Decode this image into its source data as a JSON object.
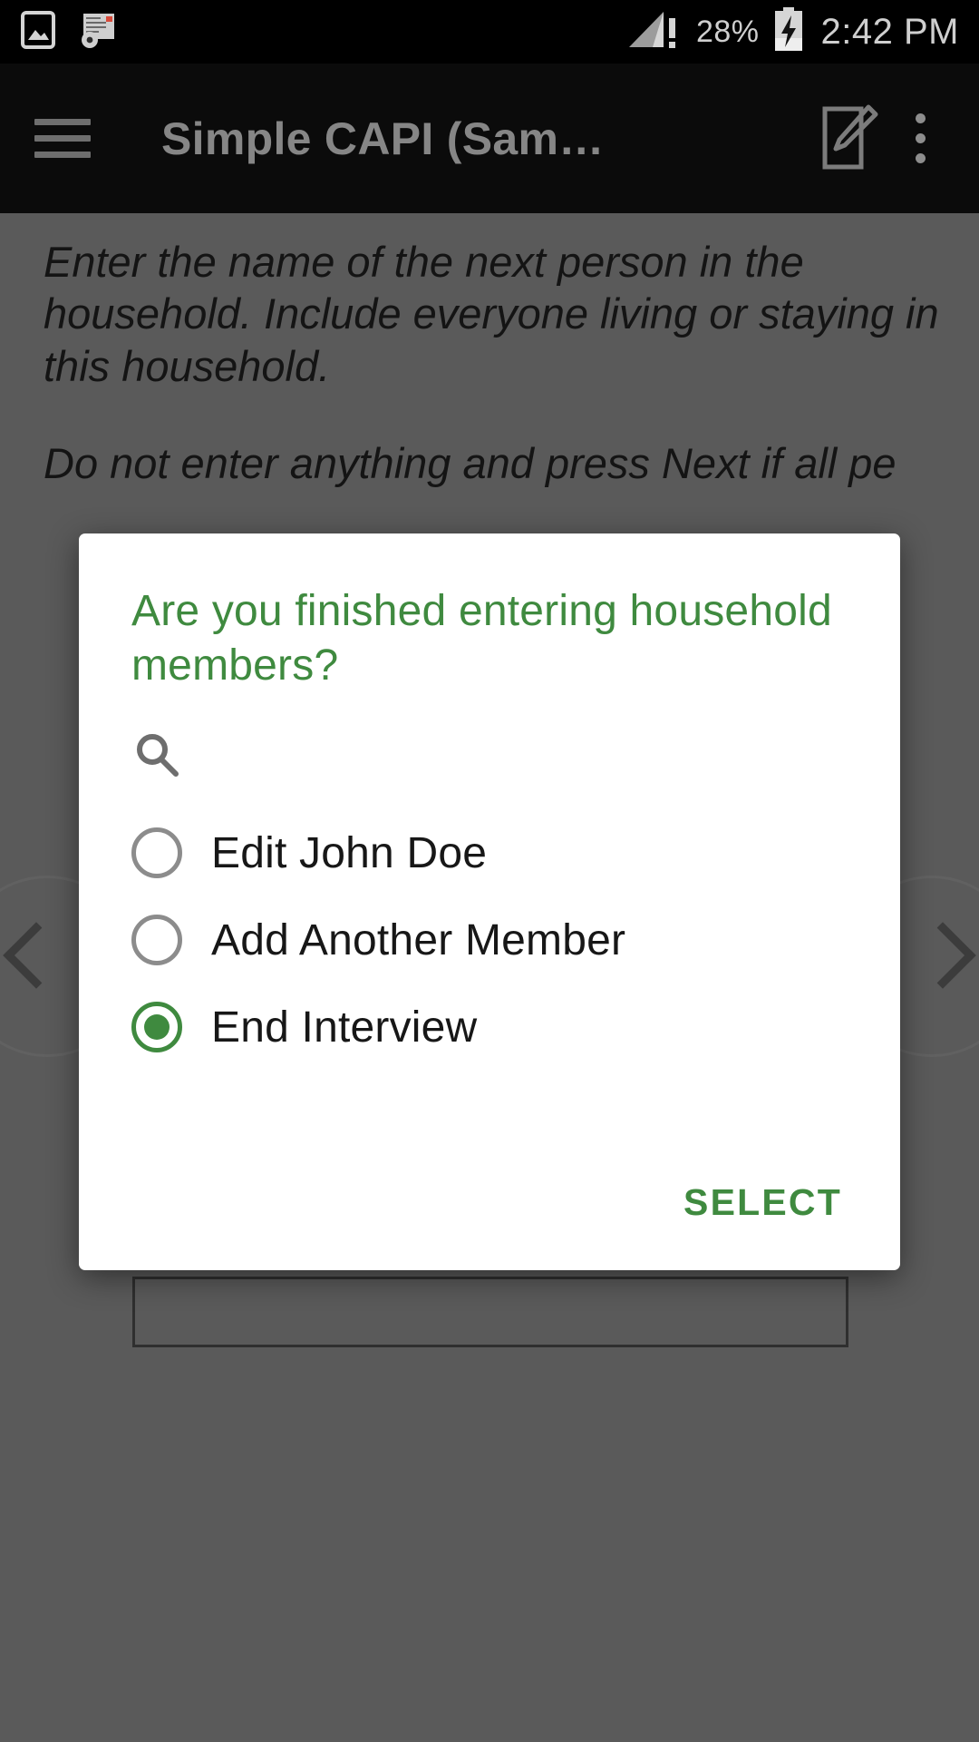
{
  "status_bar": {
    "notification_icons": [
      "image-icon",
      "document-settings-icon"
    ],
    "signal_icon": "signal-bars-warning-icon",
    "battery_percent": "28%",
    "battery_icon": "battery-charging-icon",
    "clock": "2:42 PM"
  },
  "app_bar": {
    "menu_icon": "hamburger-menu-icon",
    "title": "Simple CAPI (Sam…",
    "edit_icon": "note-edit-icon",
    "overflow_icon": "overflow-menu-icon"
  },
  "question": {
    "paragraph_1": "Enter the name of the next person in the household. Include everyone living or staying in this household.",
    "paragraph_2": "Do not enter anything and press Next if all pe",
    "answer_value": "",
    "prev_icon": "chevron-left-icon",
    "next_icon": "chevron-right-icon"
  },
  "dialog": {
    "title": "Are you finished entering household members?",
    "search_icon": "search-icon",
    "search_value": "",
    "search_placeholder": "",
    "options": [
      {
        "label": "Edit John Doe",
        "selected": false
      },
      {
        "label": "Add Another Member",
        "selected": false
      },
      {
        "label": "End Interview",
        "selected": true
      }
    ],
    "select_label": "SELECT"
  },
  "colors": {
    "accent_green": "#3f8a3f",
    "app_bar_bg": "#0b0b0b",
    "scrim_bg": "#5a5a5a",
    "status_bar_bg": "#000000"
  }
}
